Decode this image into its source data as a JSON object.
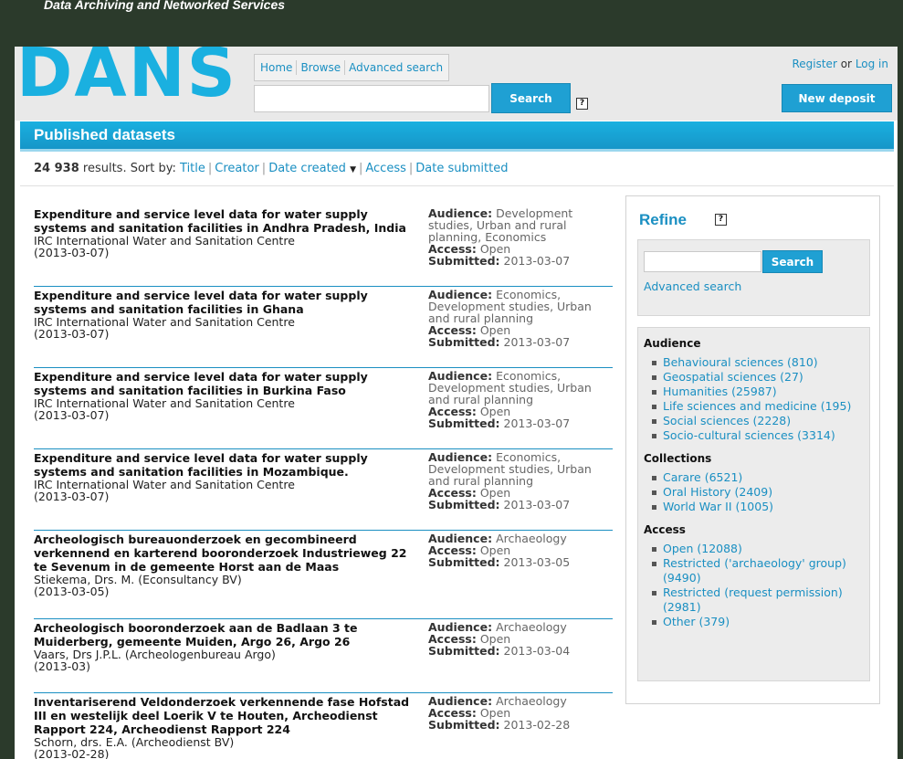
{
  "site": {
    "tagline": "Data Archiving and Networked Services",
    "logo_text": "DANS"
  },
  "nav": {
    "home": "Home",
    "browse": "Browse",
    "advanced": "Advanced search"
  },
  "search": {
    "button": "Search",
    "help": "?"
  },
  "user": {
    "register": "Register",
    "or": "or",
    "login": "Log in"
  },
  "new_deposit": "New deposit",
  "page_title": "Published datasets",
  "results": {
    "count": "24 938",
    "sort_prefix": "results. Sort by:",
    "sort_options": [
      "Title",
      "Creator",
      "Date created",
      "Access",
      "Date submitted"
    ],
    "items": [
      {
        "title": "Expenditure and service level data for water supply systems and sanitation facilities in Andhra Pradesh, India",
        "creator": "IRC International Water and Sanitation Centre",
        "date": "(2013-03-07)",
        "audience": "Development studies, Urban and rural planning, Economics",
        "access": "Open",
        "submitted": "2013-03-07"
      },
      {
        "title": "Expenditure and service level data for water supply systems and sanitation facilities in Ghana",
        "creator": "IRC International Water and Sanitation Centre",
        "date": "(2013-03-07)",
        "audience": "Economics, Development studies, Urban and rural planning",
        "access": "Open",
        "submitted": "2013-03-07"
      },
      {
        "title": "Expenditure and service level data for water supply systems and sanitation facilities in Burkina Faso",
        "creator": "IRC International Water and Sanitation Centre",
        "date": "(2013-03-07)",
        "audience": "Economics, Development studies, Urban and rural planning",
        "access": "Open",
        "submitted": "2013-03-07"
      },
      {
        "title": "Expenditure and service level data for water supply systems and sanitation facilities in Mozambique.",
        "creator": "IRC International Water and Sanitation Centre",
        "date": "(2013-03-07)",
        "audience": "Economics, Development studies, Urban and rural planning",
        "access": "Open",
        "submitted": "2013-03-07"
      },
      {
        "title": "Archeologisch bureauonderzoek en gecombineerd verkennend en karterend booronderzoek Industrieweg 22 te Sevenum in de gemeente Horst aan de Maas",
        "creator": "Stiekema, Drs. M. (Econsultancy BV)",
        "date": "(2013-03-05)",
        "audience": "Archaeology",
        "access": "Open",
        "submitted": "2013-03-05"
      },
      {
        "title": "Archeologisch booronderzoek aan de Badlaan 3 te Muiderberg, gemeente Muiden, Argo 26, Argo 26",
        "creator": "Vaars, Drs J.P.L. (Archeologenbureau Argo)",
        "date": "(2013-03)",
        "audience": "Archaeology",
        "access": "Open",
        "submitted": "2013-03-04"
      },
      {
        "title": "Inventariserend Veldonderzoek verkennende fase Hofstad III en westelijk deel Loerik V te Houten, Archeodienst Rapport 224, Archeodienst Rapport 224",
        "creator": "Schorn, drs. E.A. (Archeodienst BV)",
        "date": "(2013-02-28)",
        "audience": "Archaeology",
        "access": "Open",
        "submitted": "2013-02-28"
      }
    ],
    "labels": {
      "audience": "Audience:",
      "access": "Access:",
      "submitted": "Submitted:"
    }
  },
  "refine": {
    "title": "Refine",
    "help": "?",
    "search_button": "Search",
    "advanced_link": "Advanced search",
    "facets": [
      {
        "heading": "Audience",
        "items": [
          "Behavioural sciences (810)",
          "Geospatial sciences (27)",
          "Humanities (25987)",
          "Life sciences and medicine (195)",
          "Social sciences (2228)",
          "Socio-cultural sciences (3314)"
        ]
      },
      {
        "heading": "Collections",
        "items": [
          "Carare (6521)",
          "Oral History (2409)",
          "World War II (1005)"
        ]
      },
      {
        "heading": "Access",
        "items": [
          "Open (12088)",
          "Restricted ('archaeology' group) (9490)",
          "Restricted (request permission) (2981)",
          "Other (379)"
        ]
      }
    ]
  },
  "colors": {
    "brand_blue": "#1fa0d3",
    "link_blue": "#1a8fc2",
    "background_dark": "#2b3a2b"
  }
}
